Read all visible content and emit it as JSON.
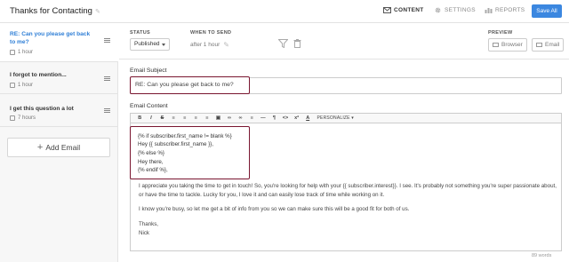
{
  "header": {
    "title": "Thanks for Contacting",
    "tabs": [
      {
        "label": "CONTENT",
        "icon": "envelope-icon",
        "active": true
      },
      {
        "label": "SETTINGS",
        "icon": "gear-icon",
        "active": false
      },
      {
        "label": "REPORTS",
        "icon": "bar-chart-icon",
        "active": false
      }
    ],
    "save_label": "Save All"
  },
  "sidebar": {
    "items": [
      {
        "subject": "RE: Can you please get back to me?",
        "time": "1 hour",
        "active": true
      },
      {
        "subject": "I forgot to mention...",
        "time": "1 hour",
        "active": false
      },
      {
        "subject": "I get this question a lot",
        "time": "7 hours",
        "active": false
      }
    ],
    "add_label": "Add Email"
  },
  "settings": {
    "status_label": "STATUS",
    "status_value": "Published",
    "when_label": "WHEN TO SEND",
    "when_value": "after 1 hour",
    "preview_label": "PREVIEW",
    "preview_browser": "Browser",
    "preview_email": "Email"
  },
  "editor": {
    "subject_label": "Email Subject",
    "subject_value": "RE: Can you please get back to me?",
    "content_label": "Email Content",
    "toolbar": [
      "B",
      "I",
      "S",
      "≡",
      "≡",
      "≡",
      "≡",
      "▣",
      "∞",
      "∞",
      "≡",
      "—",
      "¶",
      "<>",
      "x²",
      "A"
    ],
    "personalize_label": "PERSONALIZE",
    "code_lines": [
      "{% if subscriber.first_name != blank %}",
      "Hey {{ subscriber.first_name }},",
      "{% else %}",
      "Hey there,",
      "{% endif %},"
    ],
    "paragraphs": [
      "I appreciate you taking the time to get in touch! So, you're looking for help with your {{ subscriber.interest}}. I see. It's probably not something you're super passionate about, or have the time to tackle. Lucky for you, I love it and can easily lose track of time while working on it.",
      "I know you're busy, so let me get a bit of info from you so we can make sure this will be a good fit for both of us."
    ],
    "signoff": "Thanks,",
    "signature": "Nick",
    "word_count": "89 words"
  }
}
